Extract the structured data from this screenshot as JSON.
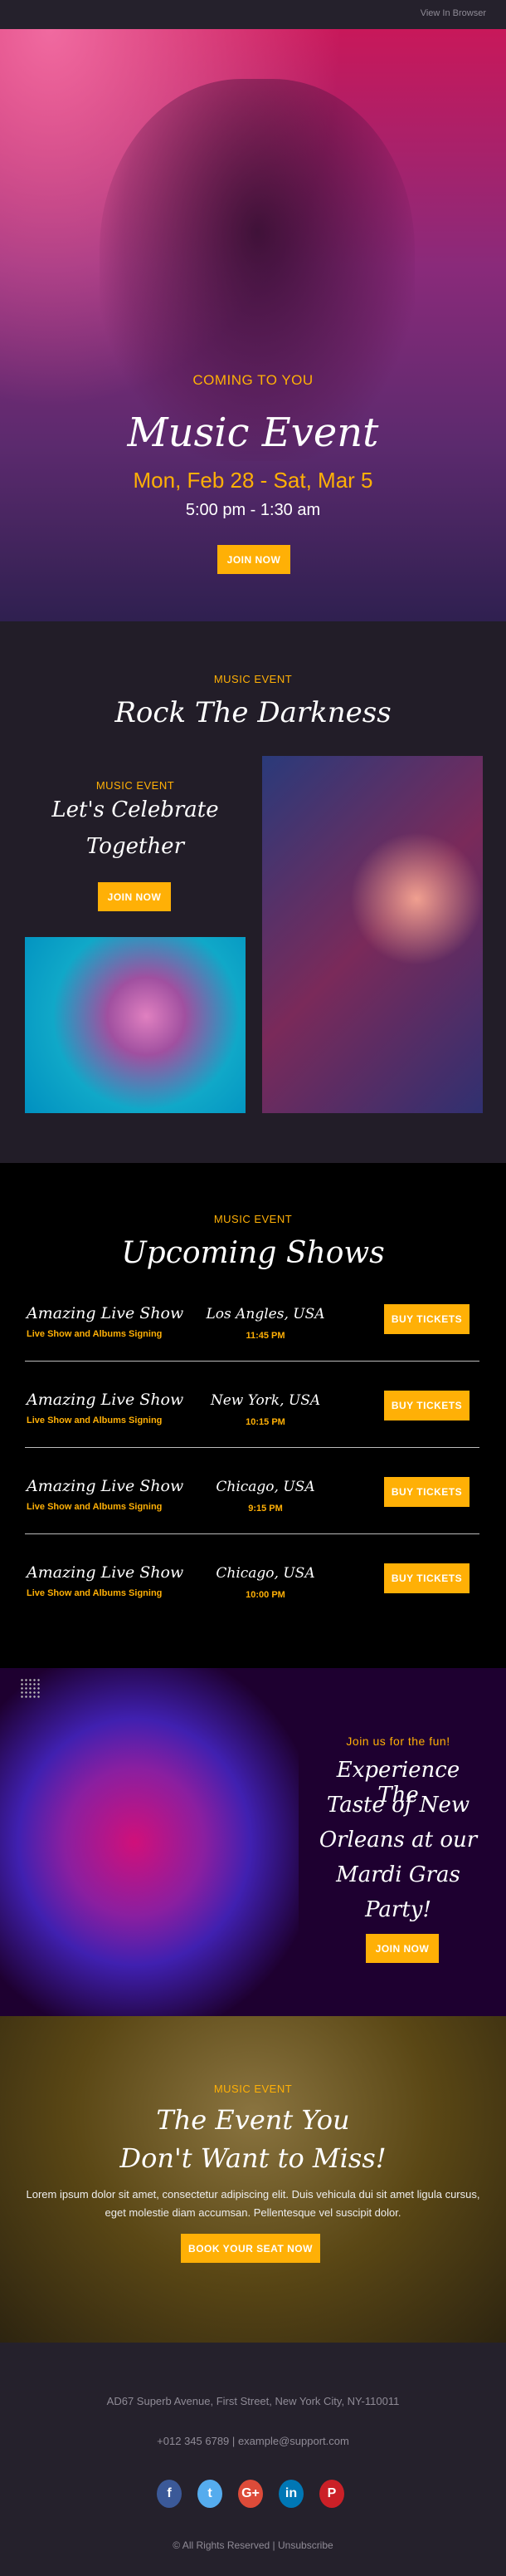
{
  "topbar": {
    "view_in_browser": "View In Browser"
  },
  "hero": {
    "kicker": "COMING TO YOU",
    "title": "Music Event",
    "dates": "Mon, Feb 28 - Sat, Mar 5",
    "time": "5:00 pm - 1:30 am",
    "button": "JOIN NOW"
  },
  "rock": {
    "kicker": "MUSIC EVENT",
    "title": "Rock The Darkness",
    "sub_kicker": "MUSIC EVENT",
    "sub_title_1": "Let's Celebrate",
    "sub_title_2": "Together",
    "button": "JOIN NOW"
  },
  "shows": {
    "kicker": "MUSIC EVENT",
    "title": "Upcoming Shows",
    "button": "BUY TICKETS",
    "rows": [
      {
        "title": "Amazing Live Show",
        "subtitle": "Live Show and Albums Signing",
        "city": "Los Angles, USA",
        "time": "11:45 PM"
      },
      {
        "title": "Amazing Live Show",
        "subtitle": "Live Show and Albums Signing",
        "city": "New York, USA",
        "time": "10:15 PM"
      },
      {
        "title": "Amazing Live Show",
        "subtitle": "Live Show and Albums Signing",
        "city": "Chicago, USA",
        "time": "9:15 PM"
      },
      {
        "title": "Amazing Live Show",
        "subtitle": "Live Show and Albums Signing",
        "city": "Chicago, USA",
        "time": "10:00 PM"
      }
    ]
  },
  "mardi": {
    "kicker": "Join us for the fun!",
    "title": [
      "Experience The",
      "Taste of New",
      "Orleans at our",
      "Mardi Gras",
      "Party!"
    ],
    "button": "JOIN NOW"
  },
  "promo": {
    "kicker": "MUSIC EVENT",
    "title_1": "The Event You",
    "title_2": "Don't Want to Miss!",
    "body": "Lorem ipsum dolor sit amet, consectetur adipiscing elit. Duis vehicula dui sit amet ligula cursus, eget molestie diam accumsan. Pellentesque vel suscipit dolor.",
    "button": "BOOK YOUR SEAT NOW"
  },
  "footer": {
    "address": "AD67 Superb Avenue, First Street, New York City, NY-110011",
    "phone": "+012 345 6789",
    "sep": "|",
    "email": "example@support.com",
    "copyright": "© All Rights Reserved",
    "unsubscribe": "Unsubscribe",
    "social": [
      {
        "icon": "facebook-icon",
        "glyph": "f",
        "color": "#3b5998"
      },
      {
        "icon": "twitter-icon",
        "glyph": "t",
        "color": "#55acee"
      },
      {
        "icon": "google-plus-icon",
        "glyph": "G+",
        "color": "#dd4b39"
      },
      {
        "icon": "linkedin-icon",
        "glyph": "in",
        "color": "#0077b5"
      },
      {
        "icon": "pinterest-icon",
        "glyph": "P",
        "color": "#cb2027"
      }
    ]
  },
  "colors": {
    "accent": "#ffb006",
    "footer_bg": "#25212c"
  }
}
